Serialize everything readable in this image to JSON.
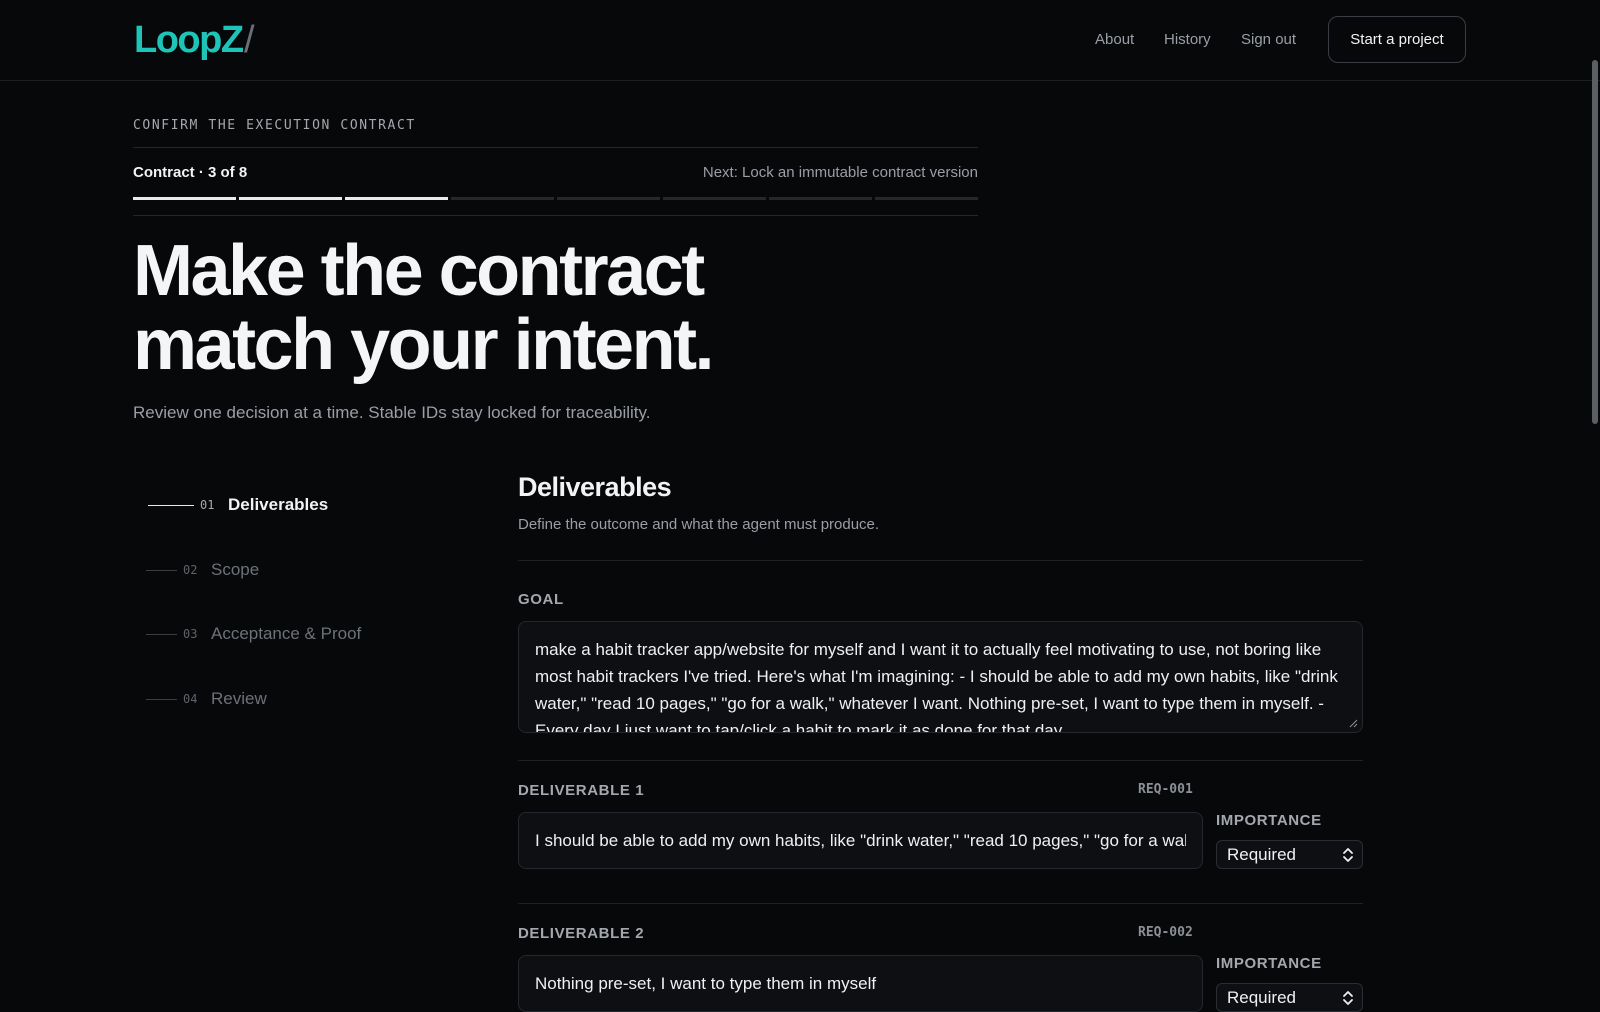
{
  "header": {
    "logo": "LoopZ",
    "logo_slash": "/",
    "nav": [
      "About",
      "History",
      "Sign out"
    ],
    "cta": "Start a project"
  },
  "step": {
    "eyebrow": "CONFIRM THE EXECUTION CONTRACT",
    "label": "Contract · 3 of 8",
    "next": "Next: Lock an immutable contract version",
    "current": 3,
    "total": 8
  },
  "hero": {
    "line1": "Make the contract",
    "line2": "match your intent.",
    "subtitle": "Review one decision at a time. Stable IDs stay locked for traceability."
  },
  "sidenav": [
    {
      "num": "01",
      "label": "Deliverables",
      "active": true
    },
    {
      "num": "02",
      "label": "Scope",
      "active": false
    },
    {
      "num": "03",
      "label": "Acceptance & Proof",
      "active": false
    },
    {
      "num": "04",
      "label": "Review",
      "active": false
    }
  ],
  "section": {
    "title": "Deliverables",
    "subtitle": "Define the outcome and what the agent must produce.",
    "goal_label": "GOAL",
    "goal_text": "make a habit tracker app/website for myself and I want it to actually feel motivating to use, not boring like most habit trackers I've tried. Here's what I'm imagining: - I should be able to add my own habits, like \"drink water,\" \"read 10 pages,\" \"go for a walk,\" whatever I want. Nothing pre-set, I want to type them in myself. - Every day I just want to tap/click a habit to mark it as done for that day.",
    "importance_label": "IMPORTANCE",
    "deliverables": [
      {
        "label": "DELIVERABLE 1",
        "id": "REQ-001",
        "value": "I should be able to add my own habits, like \"drink water,\" \"read 10 pages,\" \"go for a walk,\" whatever I want",
        "importance": "Required"
      },
      {
        "label": "DELIVERABLE 2",
        "id": "REQ-002",
        "value": "Nothing pre-set, I want to type them in myself",
        "importance": "Required"
      }
    ]
  },
  "colors": {
    "background": "#07080a",
    "accent": "#1fc4b8",
    "text": "#f2f3f5",
    "muted": "#9a9ea6"
  }
}
